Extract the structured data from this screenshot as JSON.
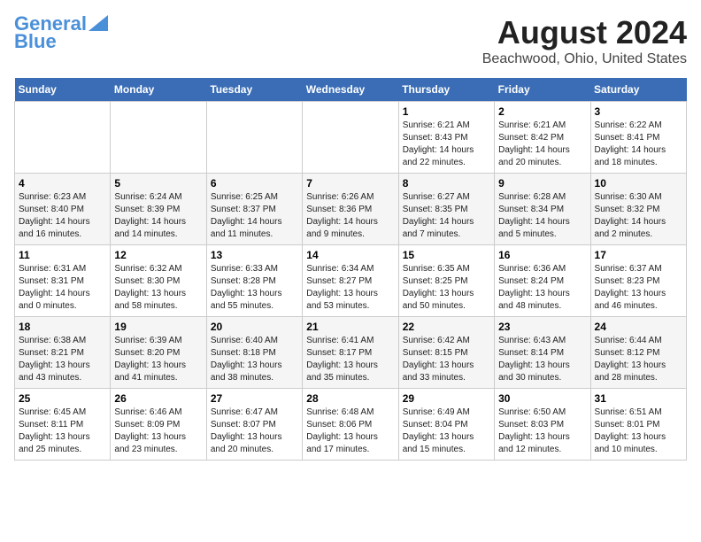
{
  "header": {
    "logo_line1": "General",
    "logo_line2": "Blue",
    "title": "August 2024",
    "subtitle": "Beachwood, Ohio, United States"
  },
  "columns": [
    "Sunday",
    "Monday",
    "Tuesday",
    "Wednesday",
    "Thursday",
    "Friday",
    "Saturday"
  ],
  "weeks": [
    [
      {
        "day": "",
        "detail": ""
      },
      {
        "day": "",
        "detail": ""
      },
      {
        "day": "",
        "detail": ""
      },
      {
        "day": "",
        "detail": ""
      },
      {
        "day": "1",
        "detail": "Sunrise: 6:21 AM\nSunset: 8:43 PM\nDaylight: 14 hours\nand 22 minutes."
      },
      {
        "day": "2",
        "detail": "Sunrise: 6:21 AM\nSunset: 8:42 PM\nDaylight: 14 hours\nand 20 minutes."
      },
      {
        "day": "3",
        "detail": "Sunrise: 6:22 AM\nSunset: 8:41 PM\nDaylight: 14 hours\nand 18 minutes."
      }
    ],
    [
      {
        "day": "4",
        "detail": "Sunrise: 6:23 AM\nSunset: 8:40 PM\nDaylight: 14 hours\nand 16 minutes."
      },
      {
        "day": "5",
        "detail": "Sunrise: 6:24 AM\nSunset: 8:39 PM\nDaylight: 14 hours\nand 14 minutes."
      },
      {
        "day": "6",
        "detail": "Sunrise: 6:25 AM\nSunset: 8:37 PM\nDaylight: 14 hours\nand 11 minutes."
      },
      {
        "day": "7",
        "detail": "Sunrise: 6:26 AM\nSunset: 8:36 PM\nDaylight: 14 hours\nand 9 minutes."
      },
      {
        "day": "8",
        "detail": "Sunrise: 6:27 AM\nSunset: 8:35 PM\nDaylight: 14 hours\nand 7 minutes."
      },
      {
        "day": "9",
        "detail": "Sunrise: 6:28 AM\nSunset: 8:34 PM\nDaylight: 14 hours\nand 5 minutes."
      },
      {
        "day": "10",
        "detail": "Sunrise: 6:30 AM\nSunset: 8:32 PM\nDaylight: 14 hours\nand 2 minutes."
      }
    ],
    [
      {
        "day": "11",
        "detail": "Sunrise: 6:31 AM\nSunset: 8:31 PM\nDaylight: 14 hours\nand 0 minutes."
      },
      {
        "day": "12",
        "detail": "Sunrise: 6:32 AM\nSunset: 8:30 PM\nDaylight: 13 hours\nand 58 minutes."
      },
      {
        "day": "13",
        "detail": "Sunrise: 6:33 AM\nSunset: 8:28 PM\nDaylight: 13 hours\nand 55 minutes."
      },
      {
        "day": "14",
        "detail": "Sunrise: 6:34 AM\nSunset: 8:27 PM\nDaylight: 13 hours\nand 53 minutes."
      },
      {
        "day": "15",
        "detail": "Sunrise: 6:35 AM\nSunset: 8:25 PM\nDaylight: 13 hours\nand 50 minutes."
      },
      {
        "day": "16",
        "detail": "Sunrise: 6:36 AM\nSunset: 8:24 PM\nDaylight: 13 hours\nand 48 minutes."
      },
      {
        "day": "17",
        "detail": "Sunrise: 6:37 AM\nSunset: 8:23 PM\nDaylight: 13 hours\nand 46 minutes."
      }
    ],
    [
      {
        "day": "18",
        "detail": "Sunrise: 6:38 AM\nSunset: 8:21 PM\nDaylight: 13 hours\nand 43 minutes."
      },
      {
        "day": "19",
        "detail": "Sunrise: 6:39 AM\nSunset: 8:20 PM\nDaylight: 13 hours\nand 41 minutes."
      },
      {
        "day": "20",
        "detail": "Sunrise: 6:40 AM\nSunset: 8:18 PM\nDaylight: 13 hours\nand 38 minutes."
      },
      {
        "day": "21",
        "detail": "Sunrise: 6:41 AM\nSunset: 8:17 PM\nDaylight: 13 hours\nand 35 minutes."
      },
      {
        "day": "22",
        "detail": "Sunrise: 6:42 AM\nSunset: 8:15 PM\nDaylight: 13 hours\nand 33 minutes."
      },
      {
        "day": "23",
        "detail": "Sunrise: 6:43 AM\nSunset: 8:14 PM\nDaylight: 13 hours\nand 30 minutes."
      },
      {
        "day": "24",
        "detail": "Sunrise: 6:44 AM\nSunset: 8:12 PM\nDaylight: 13 hours\nand 28 minutes."
      }
    ],
    [
      {
        "day": "25",
        "detail": "Sunrise: 6:45 AM\nSunset: 8:11 PM\nDaylight: 13 hours\nand 25 minutes."
      },
      {
        "day": "26",
        "detail": "Sunrise: 6:46 AM\nSunset: 8:09 PM\nDaylight: 13 hours\nand 23 minutes."
      },
      {
        "day": "27",
        "detail": "Sunrise: 6:47 AM\nSunset: 8:07 PM\nDaylight: 13 hours\nand 20 minutes."
      },
      {
        "day": "28",
        "detail": "Sunrise: 6:48 AM\nSunset: 8:06 PM\nDaylight: 13 hours\nand 17 minutes."
      },
      {
        "day": "29",
        "detail": "Sunrise: 6:49 AM\nSunset: 8:04 PM\nDaylight: 13 hours\nand 15 minutes."
      },
      {
        "day": "30",
        "detail": "Sunrise: 6:50 AM\nSunset: 8:03 PM\nDaylight: 13 hours\nand 12 minutes."
      },
      {
        "day": "31",
        "detail": "Sunrise: 6:51 AM\nSunset: 8:01 PM\nDaylight: 13 hours\nand 10 minutes."
      }
    ]
  ]
}
